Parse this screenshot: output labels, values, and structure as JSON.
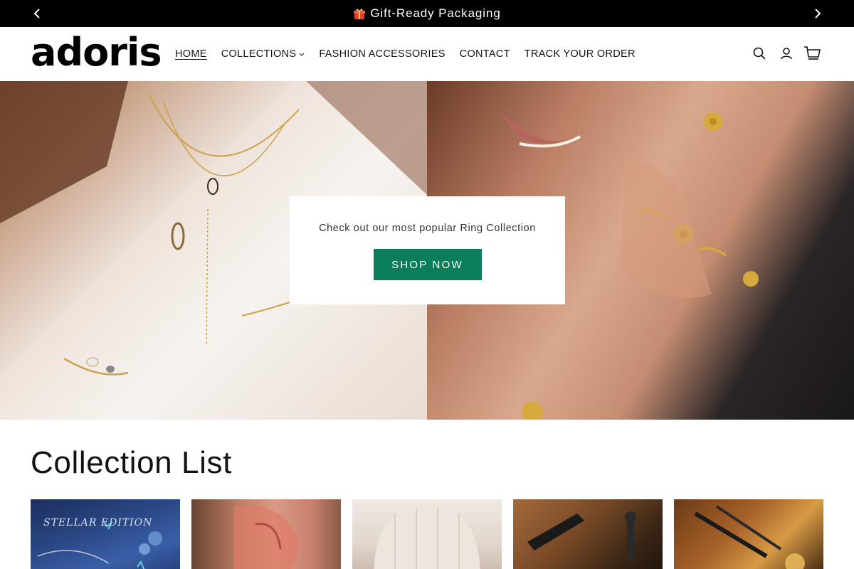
{
  "announcement": {
    "text": "Gift-Ready Packaging",
    "icon": "gift-icon",
    "prev_icon": "chevron-left-icon",
    "next_icon": "chevron-right-icon"
  },
  "header": {
    "logo": "adoris",
    "nav": [
      {
        "label": "HOME",
        "active": true
      },
      {
        "label": "COLLECTIONS",
        "has_dropdown": true
      },
      {
        "label": "FASHION ACCESSORIES"
      },
      {
        "label": "CONTACT"
      },
      {
        "label": "TRACK YOUR ORDER"
      }
    ],
    "icons": [
      "search-icon",
      "account-icon",
      "cart-icon"
    ]
  },
  "hero": {
    "text": "Check out our most popular Ring Collection",
    "button_label": "SHOP NOW",
    "button_color": "#0a7d5a"
  },
  "collections": {
    "title": "Collection List",
    "cards": [
      {
        "image_text": "STELLAR EDITION"
      },
      {},
      {},
      {},
      {}
    ]
  },
  "colors": {
    "announcement_bg": "#000000",
    "accent": "#0a7d5a",
    "text": "#121212"
  }
}
